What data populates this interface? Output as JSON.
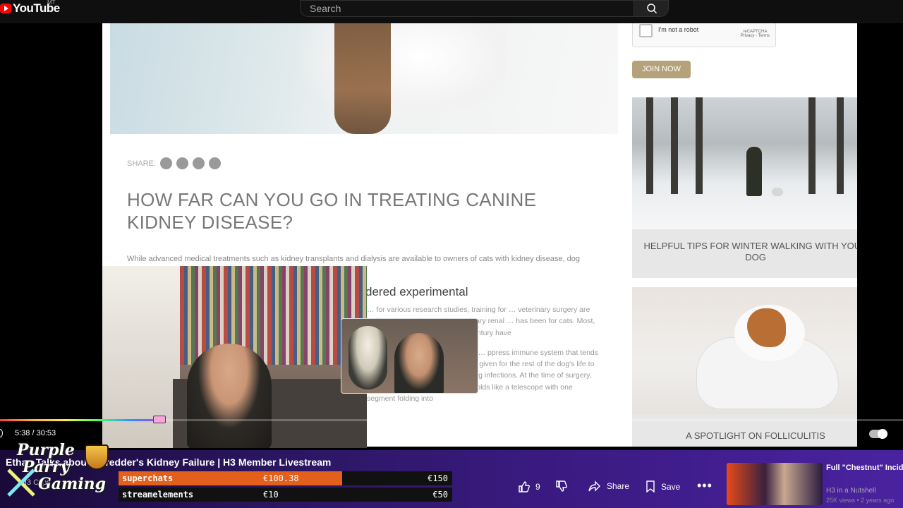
{
  "header": {
    "logo_text": "YouTube",
    "logo_superscript": "MT",
    "search_placeholder": "Search"
  },
  "article": {
    "share_label": "SHARE:",
    "title": "HOW FAR CAN YOU GO IN TREATING CANINE KIDNEY DISEASE?",
    "intro": "While advanced medical treatments such as kidney transplants and dialysis are available to owners of cats with kidney disease, dog",
    "subhead": "dered experimental",
    "body": [
      "… for various research studies, training for … veterinary surgery are well- … dous advances in veterinary renal … has been for cats. Most, if not all, … decade of the 21st century have",
      "… present a unique challenge for … ppress immune system that tends to quickly reject the newly … n be given for the rest of the dog's life to reduce rejection, but … threatening infections. At the time of surgery, dogs are also at risk … intestine folds like a telescope with one segment folding into"
    ]
  },
  "sidebar": {
    "captcha_label": "I'm not a robot",
    "captcha_brand": "reCAPTCHA",
    "captcha_terms": "Privacy - Terms",
    "join_button": "JOIN NOW",
    "card1_title": "HELPFUL TIPS FOR WINTER WALKING WITH YOUR DOG",
    "card2_title": "A SPOTLIGHT ON FOLLICULITIS"
  },
  "player": {
    "time_current": "5:38",
    "time_total": "30:53",
    "time_display": "5:38 / 30:53",
    "progress_fraction": 0.182
  },
  "video_info": {
    "title": "Ethan Talks about Shredder's Kidney Failure | H3 Member Livestream",
    "channel": "H3 Clips",
    "likes": "9",
    "share_label": "Share",
    "save_label": "Save",
    "more_label": "•••"
  },
  "overlay": {
    "badge_line1": "Purple",
    "badge_line2": "Parry",
    "badge_line3": "Gaming",
    "goals": [
      {
        "label": "superchats",
        "current": "€100.38",
        "max": "€150",
        "fill_fraction": 0.67
      },
      {
        "label": "streamelements",
        "current": "€10",
        "max": "€50",
        "fill_fraction": 0.0
      }
    ]
  },
  "recommendation": {
    "title": "Full \"Chestnut\" Incident - Apologizes to QTCinderella",
    "channel": "H3 in a Nutshell",
    "meta": "25K views • 2 years ago"
  }
}
